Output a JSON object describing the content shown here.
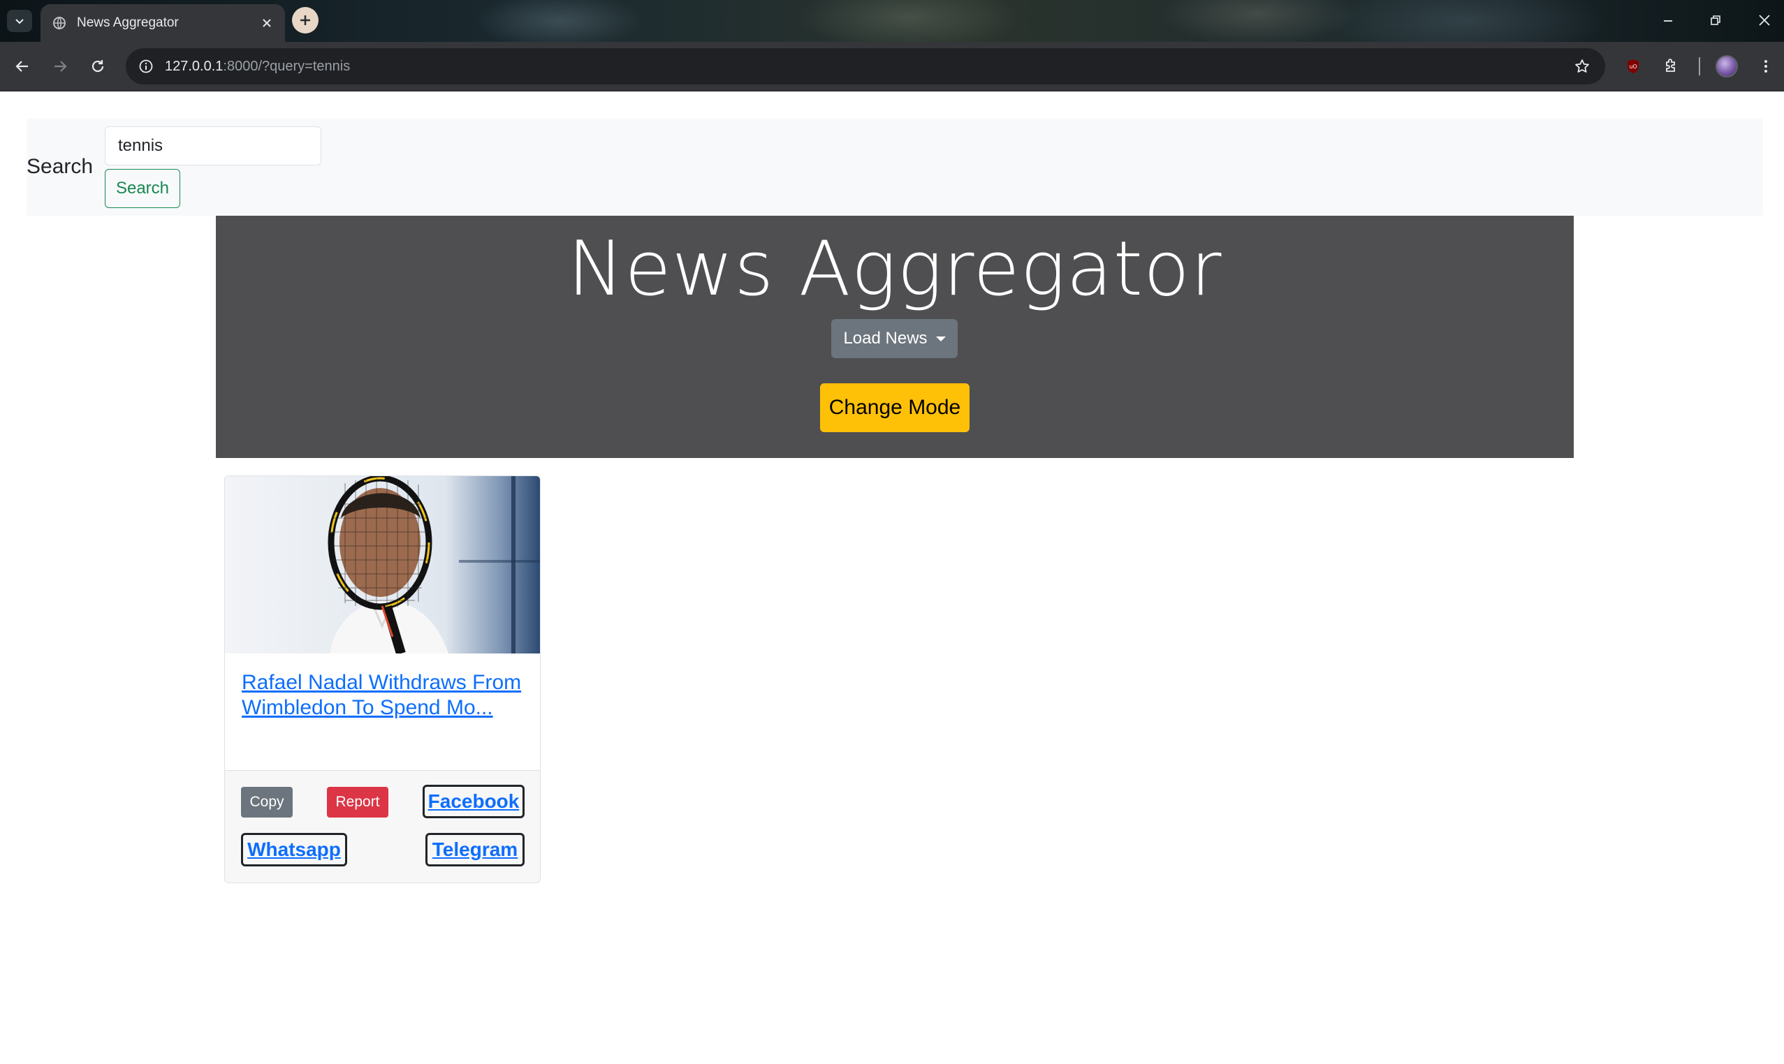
{
  "browser": {
    "tab_title": "News Aggregator",
    "url_host": "127.0.0.1",
    "url_rest": ":8000/?query=tennis"
  },
  "search": {
    "label": "Search",
    "input_value": "tennis",
    "button_label": "Search"
  },
  "hero": {
    "title": "News Aggregator",
    "load_news_label": "Load News",
    "change_mode_label": "Change Mode"
  },
  "articles": [
    {
      "title": "Rafael Nadal Withdraws From Wimbledon To Spend Mo...",
      "copy_label": "Copy",
      "report_label": "Report",
      "facebook_label": "Facebook",
      "whatsapp_label": "Whatsapp",
      "telegram_label": "Telegram"
    }
  ],
  "colors": {
    "hero_bg": "#4f4e50",
    "search_green": "#198754",
    "mode_yellow": "#ffc107",
    "report_red": "#dc3545",
    "copy_gray": "#6c757d",
    "link_blue": "#0d6efd"
  }
}
